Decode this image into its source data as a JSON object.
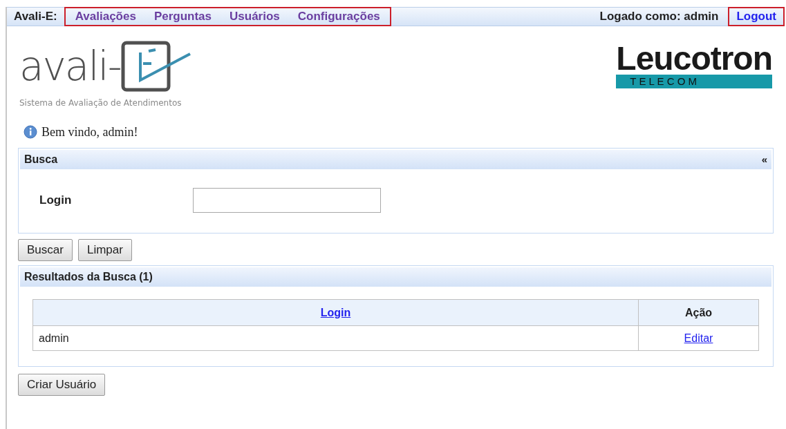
{
  "menu_bar": {
    "brand": "Avali-E:",
    "nav_highlighted": true,
    "nav": [
      {
        "label": "Avaliações"
      },
      {
        "label": "Perguntas"
      },
      {
        "label": "Usuários"
      },
      {
        "label": "Configurações"
      }
    ],
    "logged_in": "Logado como: admin",
    "logout": "Logout",
    "logout_highlighted": true
  },
  "logo": {
    "wordmark": "avali-",
    "tagline": "Sistema de Avaliação de Atendimentos"
  },
  "partner_logo": {
    "name": "Leucotron",
    "subtitle": "T E L E C O M"
  },
  "welcome": "Bem vindo, admin!",
  "search_panel": {
    "title": "Busca",
    "collapse": "«",
    "field_label": "Login"
  },
  "buttons": [
    "Buscar",
    "Limpar"
  ],
  "results_panel": {
    "title": "Resultados da Busca (1)",
    "columns": [
      {
        "label": "Login",
        "sortable": true
      },
      {
        "label": "Ação",
        "sortable": false
      }
    ],
    "rows": [
      {
        "login": "admin",
        "action": "Editar"
      }
    ]
  },
  "create_button": "Criar Usuário"
}
